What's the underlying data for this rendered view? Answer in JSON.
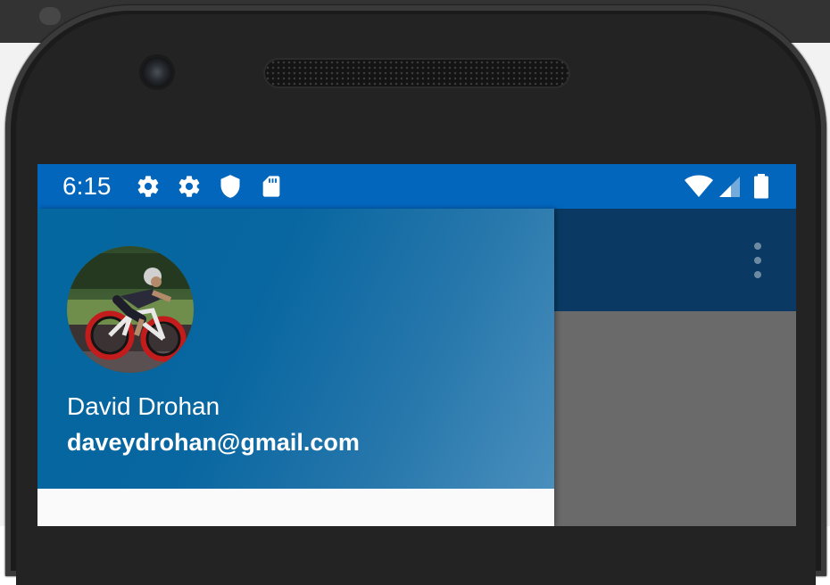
{
  "status_bar": {
    "time": "6:15",
    "left_icons": [
      "gear-icon",
      "gear-icon",
      "shield-icon",
      "sd-card-icon"
    ],
    "right_icons": [
      "wifi-icon",
      "cell-signal-icon",
      "battery-icon"
    ],
    "color": "#0366bd"
  },
  "toolbar": {
    "color": "#0a3a63",
    "menu_icon": "overflow-menu-icon"
  },
  "drawer": {
    "header": {
      "avatar_icon": "profile-photo-cyclist",
      "name": "David Drohan",
      "email": "daveydrohan@gmail.com"
    }
  }
}
